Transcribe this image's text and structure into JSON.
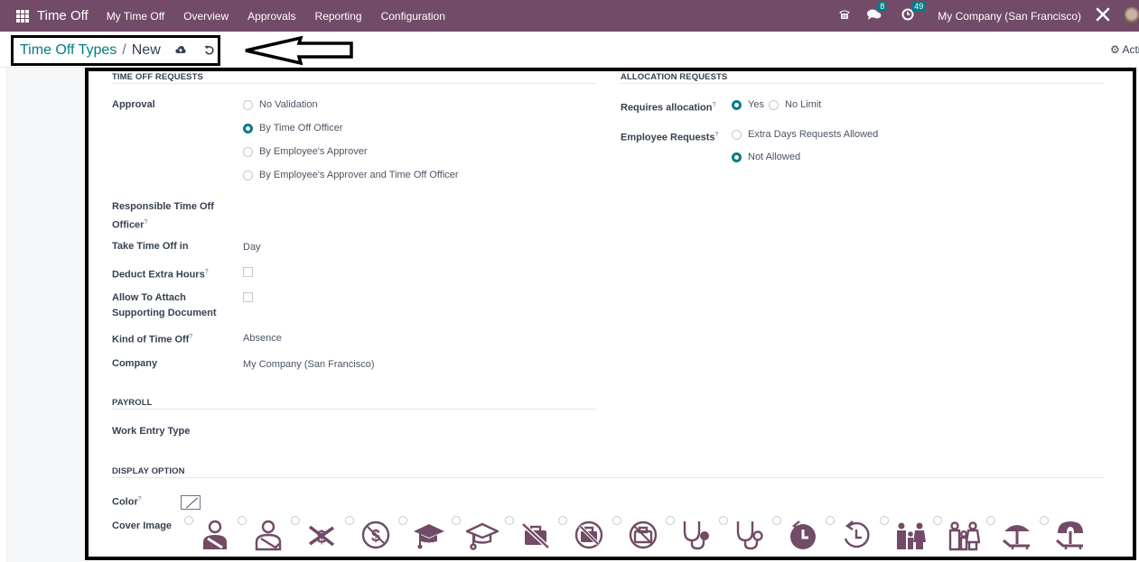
{
  "navbar": {
    "app_name": "Time Off",
    "menus": [
      "My Time Off",
      "Overview",
      "Approvals",
      "Reporting",
      "Configuration"
    ],
    "messages_badge": "8",
    "activities_badge": "49",
    "company": "My Company (San Francisco)"
  },
  "breadcrumb": {
    "parent": "Time Off Types",
    "separator": "/",
    "current": "New"
  },
  "action_label": "Acti",
  "sections": {
    "time_off_requests": "TIME OFF REQUESTS",
    "allocation_requests": "ALLOCATION REQUESTS",
    "payroll": "PAYROLL",
    "display_option": "DISPLAY OPTION"
  },
  "fields": {
    "approval": {
      "label": "Approval",
      "options": [
        "No Validation",
        "By Time Off Officer",
        "By Employee's Approver",
        "By Employee's Approver and Time Off Officer"
      ],
      "selected": "By Time Off Officer"
    },
    "responsible_officer": {
      "label_line1": "Responsible Time Off",
      "label_line2": "Officer",
      "value": ""
    },
    "take_time_off_in": {
      "label": "Take Time Off in",
      "value": "Day"
    },
    "deduct_extra_hours": {
      "label": "Deduct Extra Hours",
      "checked": false
    },
    "allow_attach": {
      "label_line1": "Allow To Attach",
      "label_line2": "Supporting Document",
      "checked": false
    },
    "kind_of_time_off": {
      "label": "Kind of Time Off",
      "value": "Absence"
    },
    "company": {
      "label": "Company",
      "value": "My Company (San Francisco)"
    },
    "requires_allocation": {
      "label": "Requires allocation",
      "options": [
        "Yes",
        "No Limit"
      ],
      "selected": "Yes"
    },
    "employee_requests": {
      "label": "Employee Requests",
      "options": [
        "Extra Days Requests Allowed",
        "Not Allowed"
      ],
      "selected": "Not Allowed"
    },
    "work_entry_type": {
      "label": "Work Entry Type",
      "value": ""
    },
    "color": {
      "label": "Color"
    },
    "cover_image": {
      "label": "Cover Image",
      "icons": [
        "injured-arm-filled-icon",
        "injured-arm-outline-icon",
        "no-money-icon",
        "no-dollar-circle-icon",
        "graduation-cap-filled-icon",
        "graduation-cap-outline-icon",
        "no-briefcase-icon",
        "no-briefcase-circle-filled-icon",
        "no-briefcase-circle-outline-icon",
        "stethoscope-filled-icon",
        "stethoscope-outline-icon",
        "time-back-filled-icon",
        "time-back-outline-icon",
        "family-filled-icon",
        "family-outline-icon",
        "beach-umbrella-icon",
        "beach-umbrella-alt-icon"
      ]
    }
  },
  "help_mark": "?",
  "colors": {
    "brand": "#714b67",
    "accent": "#017e84"
  }
}
